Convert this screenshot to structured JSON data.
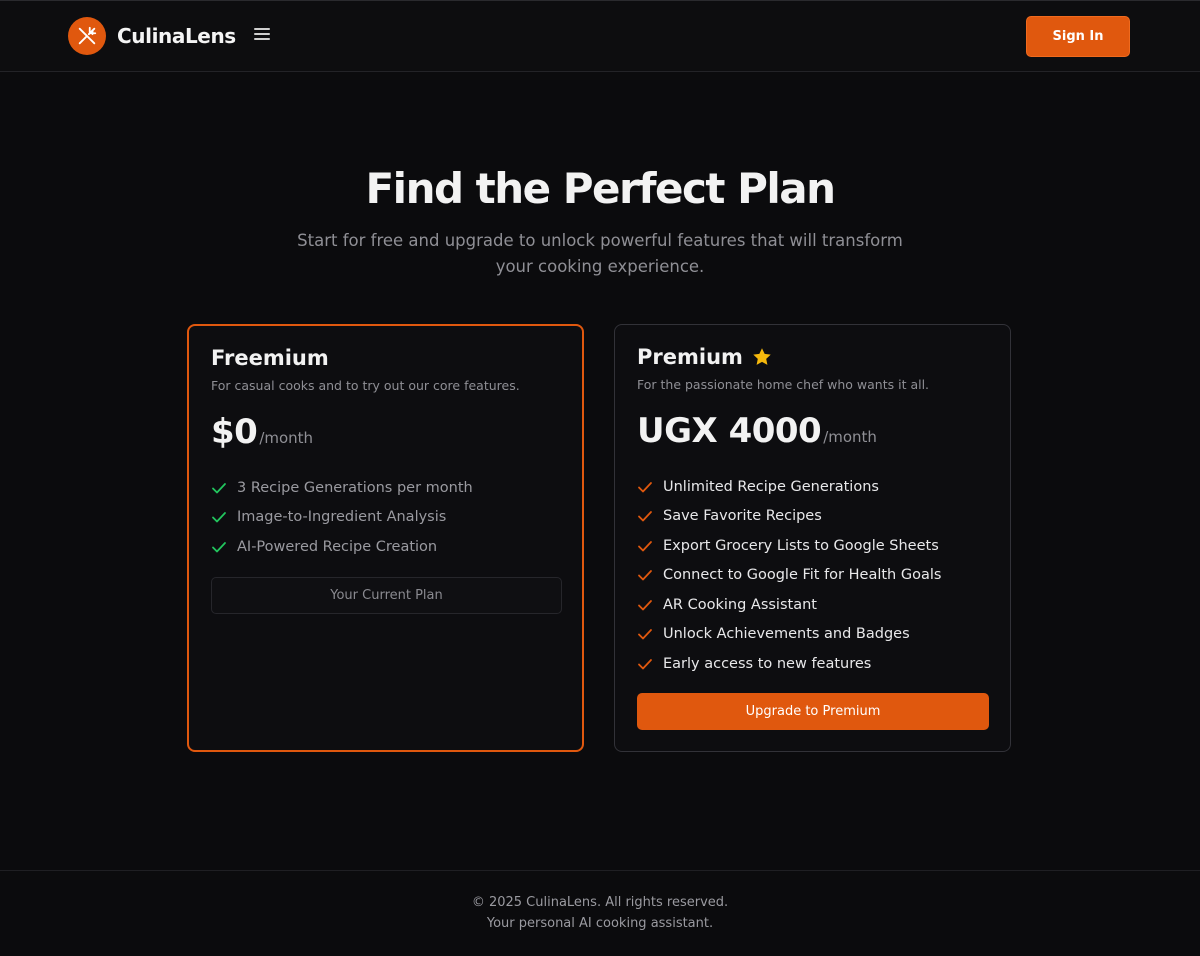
{
  "header": {
    "app_name": "CulinaLens",
    "logo_icon": "utensils-icon",
    "menu_icon": "hamburger-menu-icon",
    "signin_label": "Sign In"
  },
  "hero": {
    "title": "Find the Perfect Plan",
    "subtitle": "Start for free and upgrade to unlock powerful features that will transform your cooking experience."
  },
  "plans": [
    {
      "name": "Freemium",
      "description": "For casual cooks and to try out our core features.",
      "price": "$0",
      "period": "/month",
      "features": [
        "3 Recipe Generations per month",
        "Image-to-Ingredient Analysis",
        "AI-Powered Recipe Creation"
      ],
      "button_label": "Your Current Plan",
      "check_color": "#22c55e"
    },
    {
      "name": "Premium",
      "badge_icon": "star-icon",
      "description": "For the passionate home chef who wants it all.",
      "price": "UGX 4000",
      "period": "/month",
      "features": [
        "Unlimited Recipe Generations",
        "Save Favorite Recipes",
        "Export Grocery Lists to Google Sheets",
        "Connect to Google Fit for Health Goals",
        "AR Cooking Assistant",
        "Unlock Achievements and Badges",
        "Early access to new features"
      ],
      "button_label": "Upgrade to Premium",
      "check_color": "#e0580e"
    }
  ],
  "footer": {
    "copyright": "© 2025 CulinaLens. All rights reserved.",
    "tagline": "Your personal AI cooking assistant."
  },
  "colors": {
    "accent": "#e0580e",
    "background": "#0b0b0d",
    "star": "#f5b80c"
  }
}
